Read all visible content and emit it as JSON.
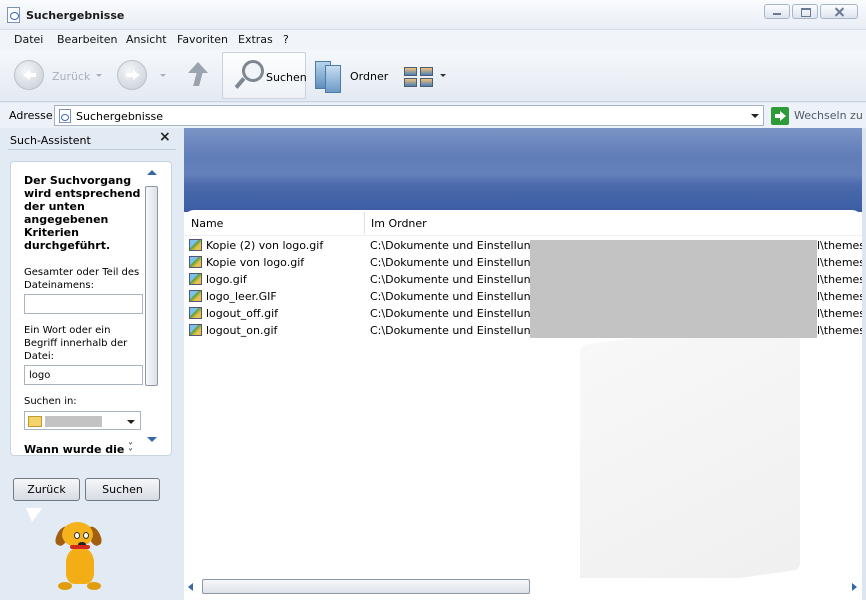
{
  "window": {
    "title": "Suchergebnisse"
  },
  "menu": [
    "Datei",
    "Bearbeiten",
    "Ansicht",
    "Favoriten",
    "Extras",
    "?"
  ],
  "toolbar": {
    "back_label": "Zurück",
    "search_label": "Suchen",
    "folders_label": "Ordner"
  },
  "address": {
    "label": "Adresse",
    "value": "Suchergebnisse",
    "go_label": "Wechseln zu"
  },
  "left_pane": {
    "title": "Such-Assistent",
    "heading": "Der Suchvorgang wird entsprechend der unten angegebenen Kriterien durchgeführt.",
    "filename_label": "Gesamter oder Teil des Dateinamens:",
    "filename_value": "",
    "word_label": "Ein Wort oder ein Begriff innerhalb der Datei:",
    "word_value": "logo",
    "search_in_label": "Suchen in:",
    "when_label": "Wann wurde die Datei geändert?",
    "back_button": "Zurück",
    "search_button": "Suchen"
  },
  "results": {
    "columns": [
      "Name",
      "Im Ordner"
    ],
    "rows": [
      {
        "name": "Kopie (2) von logo.gif",
        "path": "C:\\Dokumente und Einstellungen\\",
        "path_end": "l\\themes\\"
      },
      {
        "name": "Kopie von logo.gif",
        "path": "C:\\Dokumente und Einstellungen\\",
        "path_end": "l\\themes\\"
      },
      {
        "name": "logo.gif",
        "path": "C:\\Dokumente und Einstellungen\\",
        "path_end": "l\\themes\\"
      },
      {
        "name": "logo_leer.GIF",
        "path": "C:\\Dokumente und Einstellungen\\",
        "path_end": "l\\themes\\"
      },
      {
        "name": "logout_off.gif",
        "path": "C:\\Dokumente und Einstellungen\\",
        "path_end": "l\\themes\\"
      },
      {
        "name": "logout_on.gif",
        "path": "C:\\Dokumente und Einstellungen\\",
        "path_end": "l\\themes\\"
      }
    ]
  },
  "icons": {
    "app": "search-results-icon",
    "file": "gif-image-icon",
    "go": "green-arrow-icon",
    "assistant": "dog-assistant-icon"
  }
}
